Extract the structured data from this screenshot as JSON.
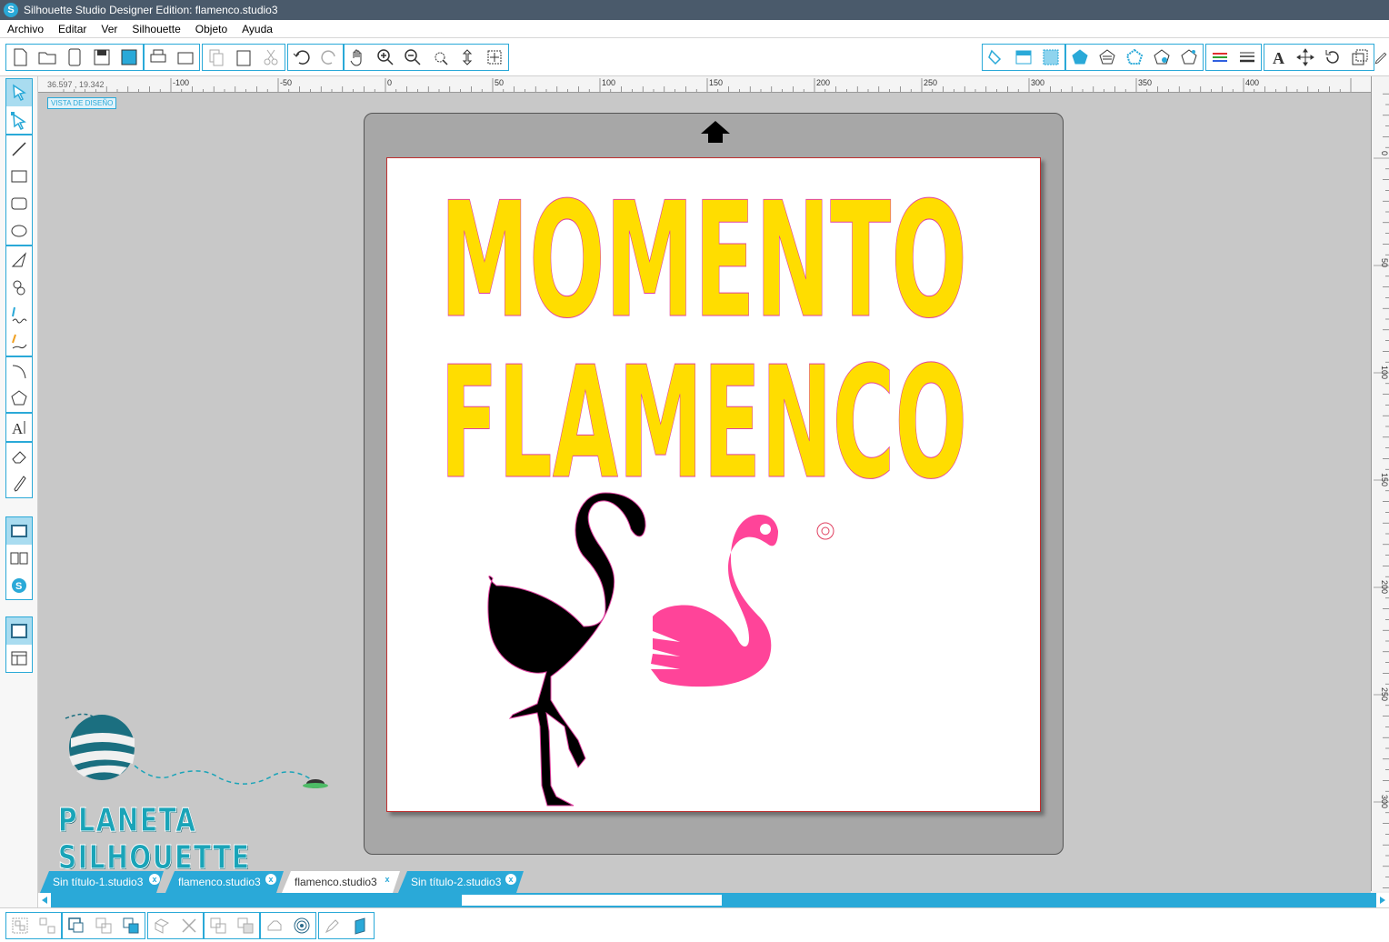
{
  "window": {
    "title": "Silhouette Studio Designer Edition: flamenco.studio3"
  },
  "menu": [
    "Archivo",
    "Editar",
    "Ver",
    "Silhouette",
    "Objeto",
    "Ayuda"
  ],
  "ruler": {
    "coords": "36.597 , 19.342",
    "top_labels": [
      "-100",
      "-50",
      "0",
      "50",
      "100",
      "150",
      "200",
      "250",
      "300",
      "350",
      "400"
    ],
    "left_labels": [
      "0",
      "50",
      "100",
      "150",
      "200",
      "250",
      "300"
    ]
  },
  "view_label": "VISTA DE DISEÑO",
  "design": {
    "line1": "MOMENTO",
    "line2": "FLAMENCO",
    "text_color": "#ffdd00",
    "outline_color": "#e040a0",
    "flamingo_black_color": "#000000",
    "flamingo_pink_color": "#ff4499"
  },
  "watermark": {
    "text": "PLANETA SILHOUETTE",
    "color": "#1aa4b8"
  },
  "tabs": [
    {
      "label": "Sin título-1.studio3",
      "active": false
    },
    {
      "label": "flamenco.studio3",
      "active": false
    },
    {
      "label": "flamenco.studio3",
      "active": true
    },
    {
      "label": "Sin título-2.studio3",
      "active": false
    }
  ],
  "colors": {
    "accent": "#2aa9d8",
    "workspace": "#c8c8c8",
    "mat": "#a7a7a7"
  }
}
